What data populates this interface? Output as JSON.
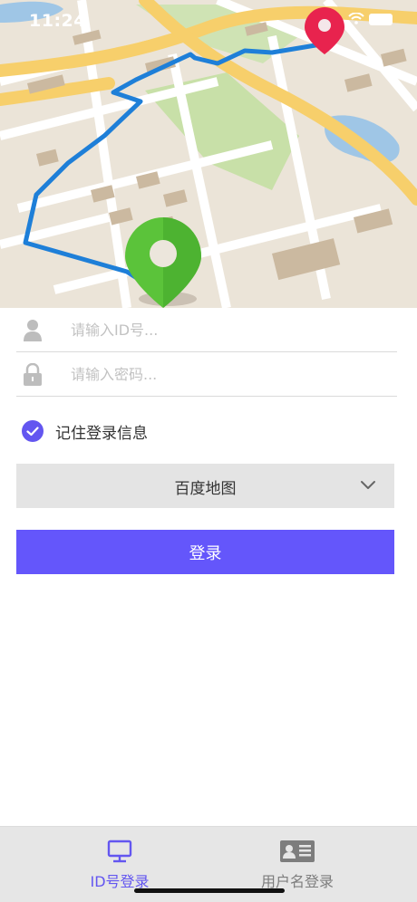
{
  "status_bar": {
    "time": "11:24"
  },
  "form": {
    "id_placeholder": "请输入ID号...",
    "password_placeholder": "请输入密码...",
    "remember_label": "记住登录信息",
    "remember_checked": true
  },
  "map_select": {
    "selected": "百度地图"
  },
  "login_button": {
    "label": "登录"
  },
  "tabs": [
    {
      "label": "ID号登录",
      "icon": "monitor-icon",
      "active": true
    },
    {
      "label": "用户名登录",
      "icon": "id-card-icon",
      "active": false
    }
  ],
  "colors": {
    "accent": "#6456fb",
    "map_pin_start": "#5bc33a",
    "map_pin_end": "#e8234e",
    "route": "#1e7fd8"
  }
}
